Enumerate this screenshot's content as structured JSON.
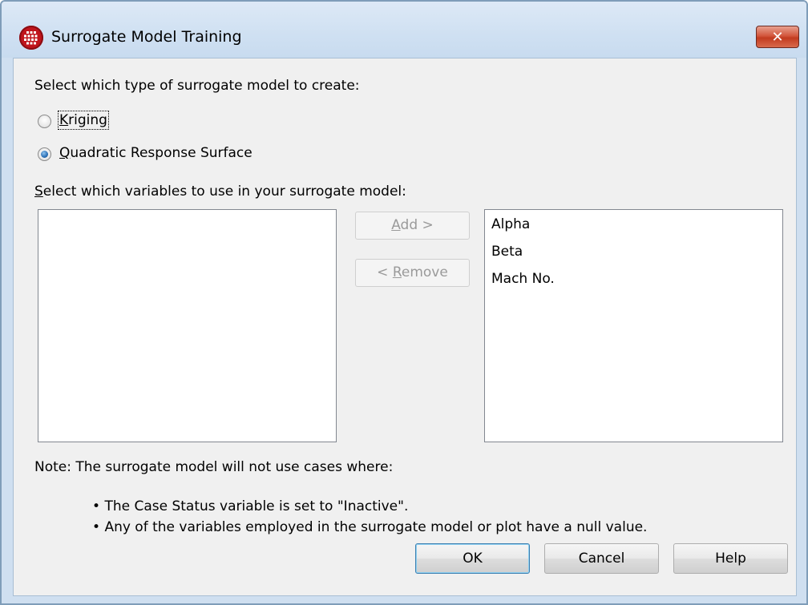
{
  "window": {
    "title": "Surrogate Model Training",
    "close_glyph": "✕"
  },
  "model_type": {
    "prompt": "Select which type of surrogate model to create:",
    "options": [
      {
        "mnemonic": "K",
        "rest": "riging",
        "checked": false
      },
      {
        "mnemonic": "Q",
        "rest": "uadratic Response Surface",
        "checked": true
      }
    ]
  },
  "variables": {
    "prompt_mnemonic": "S",
    "prompt_rest": "elect which variables to use in your surrogate model:",
    "available": [],
    "selected": [
      "Alpha",
      "Beta",
      "Mach No."
    ],
    "add_label_mnemonic": "A",
    "add_label_rest": "dd >",
    "remove_label_prefix": "< ",
    "remove_label_mnemonic": "R",
    "remove_label_rest": "emove"
  },
  "note": {
    "heading": "Note: The surrogate model will not use cases where:",
    "bullets": [
      "The Case Status variable is set to \"Inactive\".",
      "Any of the variables employed in the surrogate model or plot have a null value."
    ]
  },
  "buttons": {
    "ok": "OK",
    "cancel": "Cancel",
    "help": "Help"
  }
}
